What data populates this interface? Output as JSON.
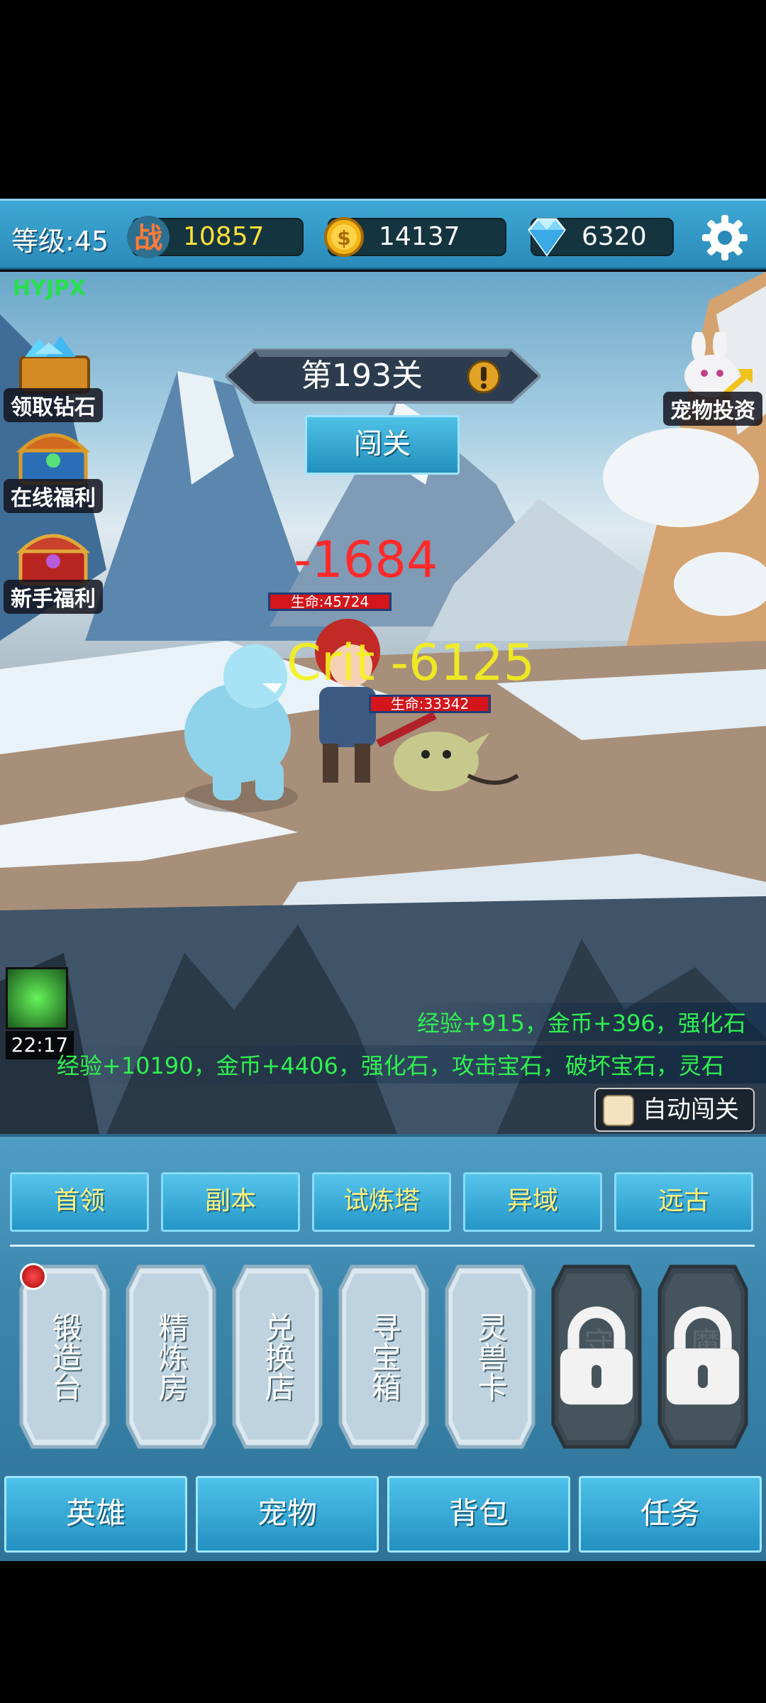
{
  "top_bar": {
    "level_text": "等级:45",
    "power": "10857",
    "power_icon_text": "战",
    "gold": "14137",
    "gems": "6320"
  },
  "scene": {
    "watermark": "HYJPX",
    "left_buttons": [
      {
        "label": "领取钻石",
        "icon": "diamond-chest-icon"
      },
      {
        "label": "在线福利",
        "icon": "treasure-chest-blue-icon"
      },
      {
        "label": "新手福利",
        "icon": "treasure-chest-red-icon"
      }
    ],
    "right_button": {
      "label": "宠物投资",
      "icon": "pet-rabbit-icon"
    },
    "stage_title": "第193关",
    "challenge_label": "闯关",
    "damage_numbers": [
      "-1684",
      "Crit -6125"
    ],
    "enemy_hp": [
      "生命:45724",
      "生命:33342"
    ],
    "skill_timer": "22:17",
    "reward_logs": [
      "经验+915，金币+396，强化石",
      "经验+10190，金币+4406，强化石，攻击宝石，破坏宝石，灵石"
    ],
    "auto_label": "自动闯关",
    "auto_checked": false
  },
  "panel": {
    "tabs": [
      "首领",
      "副本",
      "试炼塔",
      "异域",
      "远古"
    ],
    "features": [
      {
        "label": "锻造台",
        "locked": false,
        "badge": true
      },
      {
        "label": "精炼房",
        "locked": false,
        "badge": false
      },
      {
        "label": "兑换店",
        "locked": false,
        "badge": false
      },
      {
        "label": "寻宝箱",
        "locked": false,
        "badge": false
      },
      {
        "label": "灵兽卡",
        "locked": false,
        "badge": false
      },
      {
        "label": "守装",
        "locked": true,
        "badge": false
      },
      {
        "label": "魔装",
        "locked": true,
        "badge": false
      }
    ],
    "nav": [
      "英雄",
      "宠物",
      "背包",
      "任务"
    ]
  },
  "colors": {
    "accent_blue": "#2a8ab8",
    "power_yellow": "#ffe03a",
    "damage_red": "#ff2a2a",
    "crit_yellow": "#f6f21a",
    "log_green": "#2ff050"
  }
}
